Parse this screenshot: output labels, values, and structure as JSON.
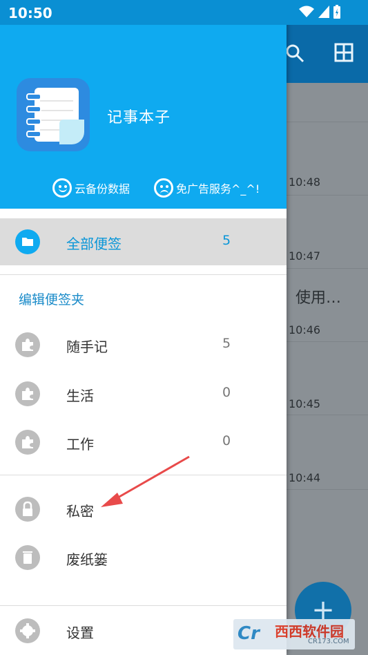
{
  "status_bar": {
    "time": "10:50"
  },
  "drawer": {
    "app_name": "记事本子",
    "header_links": [
      {
        "label": "云备份数据"
      },
      {
        "label": "免广告服务^_^!"
      }
    ],
    "all_notes": {
      "label": "全部便签",
      "count": "5"
    },
    "section_title": "编辑便签夹",
    "folders": [
      {
        "label": "随手记",
        "count": "5"
      },
      {
        "label": "生活",
        "count": "0"
      },
      {
        "label": "工作",
        "count": "0"
      }
    ],
    "private": {
      "label": "私密"
    },
    "trash": {
      "label": "废纸篓"
    },
    "settings": {
      "label": "设置"
    }
  },
  "background": {
    "note_times": [
      "10:48",
      "10:47",
      "10:46",
      "10:45",
      "10:44"
    ],
    "partial_note_title": "使用…",
    "fab_label": "+"
  },
  "watermark": {
    "logo": "Cr",
    "text": "西西软件园",
    "sub": "CR173.COM"
  },
  "colors": {
    "header_blue": "#0faaf0",
    "accent": "#0a96d8",
    "annotation_arrow": "#e84a4a"
  }
}
